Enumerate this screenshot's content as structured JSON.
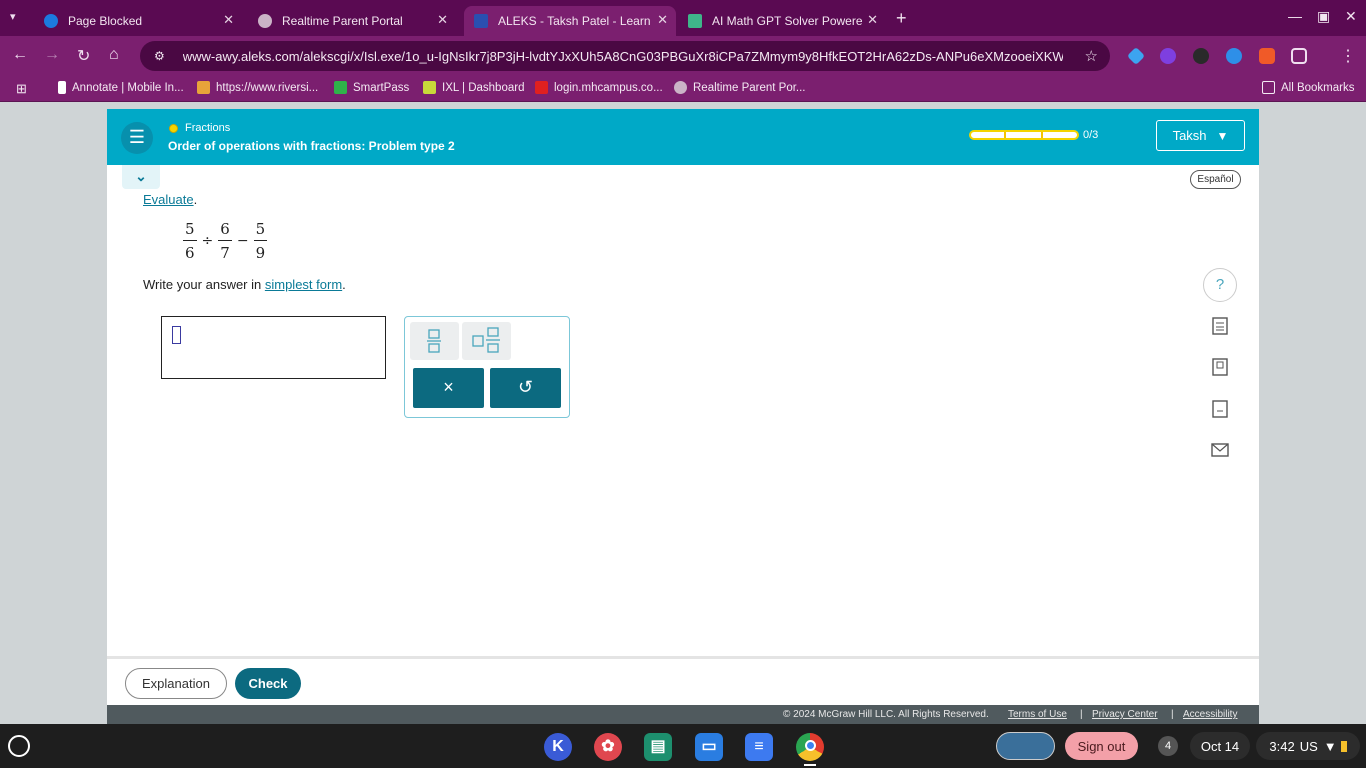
{
  "browser": {
    "tabs": [
      {
        "title": "Page Blocked",
        "active": false
      },
      {
        "title": "Realtime Parent Portal",
        "active": false
      },
      {
        "title": "ALEKS - Taksh Patel - Learn",
        "active": true
      },
      {
        "title": "AI Math GPT Solver Powered b",
        "active": false
      }
    ],
    "url": "www-awy.aleks.com/alekscgi/x/Isl.exe/1o_u-IgNsIkr7j8P3jH-lvdtYJxXUh5A8CnG03PBGuXr8iCPa7ZMmym9y8HfkEOT2HrA62zDs-ANPu6eXMzooeiXKW4z4lnji...",
    "bookmarks": [
      "Annotate | Mobile In...",
      "https://www.riversi...",
      "SmartPass",
      "IXL | Dashboard",
      "login.mhcampus.co...",
      "Realtime Parent Por..."
    ],
    "all_bookmarks": "All Bookmarks"
  },
  "header": {
    "topic": "Fractions",
    "problem_title": "Order of operations with fractions: Problem type 2",
    "progress_text": "0/3",
    "user_name": "Taksh"
  },
  "language_button": "Español",
  "problem": {
    "instruction_link": "Evaluate",
    "instruction_suffix": ".",
    "expression": {
      "f1": {
        "num": "5",
        "den": "6"
      },
      "op1": "÷",
      "f2": {
        "num": "6",
        "den": "7"
      },
      "op2": "−",
      "f3": {
        "num": "5",
        "den": "9"
      }
    },
    "write_prefix": "Write your answer in ",
    "write_link": "simplest form",
    "write_suffix": "."
  },
  "keypad": {
    "clear": "×",
    "undo": "↺"
  },
  "side_tools": [
    "help-icon",
    "calculator-icon",
    "ebook-icon",
    "dictionary-icon",
    "mail-icon"
  ],
  "side_help_glyph": "?",
  "buttons": {
    "explanation": "Explanation",
    "check": "Check"
  },
  "footer": {
    "copyright": "© 2024 McGraw Hill LLC. All Rights Reserved.",
    "terms": "Terms of Use",
    "privacy": "Privacy Center",
    "accessibility": "Accessibility",
    "sep": "|"
  },
  "shelf": {
    "sign_out": "Sign out",
    "notification_count": "4",
    "date": "Oct 14",
    "time": "3:42",
    "locale": "US"
  },
  "colors": {
    "brand_teal": "#00a9c7",
    "button_dark": "#0c6a80",
    "browser_frame": "#7b1f6f",
    "sign_out": "#f3a0a8"
  }
}
